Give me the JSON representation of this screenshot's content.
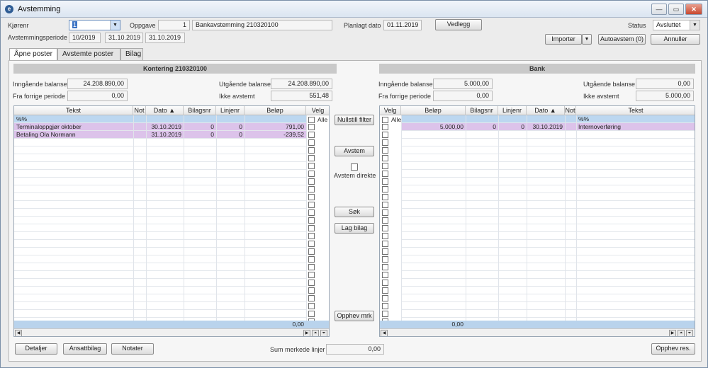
{
  "window": {
    "title": "Avstemming",
    "icon": "app-logo-icon",
    "min_label": "—",
    "max_label": "▭",
    "close_label": "✕"
  },
  "header": {
    "kjorenr_label": "Kjørenr",
    "kjorenr_value": "1",
    "oppgave_label": "Oppgave",
    "oppgave_value": "1",
    "oppgave_name": "Bankavstemming 210320100",
    "planlagt_label": "Planlagt dato",
    "planlagt_value": "01.11.2019",
    "vedlegg_label": "Vedlegg",
    "status_label": "Status",
    "status_value": "Avsluttet",
    "periode_label": "Avstemmingsperiode",
    "periode_value": "10/2019",
    "periode_from": "31.10.2019",
    "periode_to": "31.10.2019",
    "importer_label": "Importer",
    "autoavstem_label": "Autoavstem (0)",
    "annuller_label": "Annuller"
  },
  "tabs": [
    {
      "label": "Åpne poster"
    },
    {
      "label": "Avstemte poster"
    },
    {
      "label": "Bilag"
    }
  ],
  "left": {
    "title": "Kontering 210320100",
    "inngaende_label": "Inngående balanse",
    "inngaende_value": "24.208.890,00",
    "fra_forrige_label": "Fra forrige periode",
    "fra_forrige_value": "0,00",
    "utgaende_label": "Utgående balanse",
    "utgaende_value": "24.208.890,00",
    "ikke_avstemt_label": "Ikke avstemt",
    "ikke_avstemt_value": "551,48",
    "columns": [
      "Tekst",
      "Not",
      "Dato ▲",
      "Bilagsnr",
      "Linjenr",
      "Beløp",
      "Velg"
    ],
    "filter_text": "%%",
    "alle_label": "Alle",
    "rows": [
      {
        "tekst": "Terminaloppgjør oktober",
        "dato": "30.10.2019",
        "bilagsnr": "0",
        "linjenr": "0",
        "belop": "791,00"
      },
      {
        "tekst": "Betaling Ola Normann",
        "dato": "31.10.2019",
        "bilagsnr": "0",
        "linjenr": "0",
        "belop": "-239,52"
      }
    ],
    "sum": "0,00"
  },
  "middle": {
    "nullstill_label": "Nullstill filter",
    "avstem_label": "Avstem",
    "avstem_direkte_label": "Avstem direkte",
    "sok_label": "Søk",
    "lag_bilag_label": "Lag bilag",
    "opphev_mrk_label": "Opphev mrk"
  },
  "right": {
    "title": "Bank",
    "inngaende_label": "Inngående balanse",
    "inngaende_value": "5.000,00",
    "fra_forrige_label": "Fra forrige periode",
    "fra_forrige_value": "0,00",
    "utgaende_label": "Utgående balanse",
    "utgaende_value": "0,00",
    "ikke_avstemt_label": "Ikke avstemt",
    "ikke_avstemt_value": "5.000,00",
    "columns": [
      "Velg",
      "Beløp",
      "Bilagsnr",
      "Linjenr",
      "Dato ▲",
      "Not",
      "Tekst"
    ],
    "filter_text": "%%",
    "alle_label": "Alle",
    "rows": [
      {
        "belop": "5.000,00",
        "bilagsnr": "0",
        "linjenr": "0",
        "dato": "30.10.2019",
        "tekst": "Internoverføring"
      }
    ],
    "sum": "0,00"
  },
  "footer": {
    "detaljer_label": "Detaljer",
    "ansattbilag_label": "Ansattbilag",
    "notater_label": "Notater",
    "sum_merkede_label": "Sum merkede linjer",
    "sum_merkede_value": "0,00",
    "opphev_res_label": "Opphev res."
  },
  "colors": {
    "filter_row": "#bcd7f0",
    "data_row": "#dcc3ea",
    "sum_bar": "#b9d3ec"
  }
}
